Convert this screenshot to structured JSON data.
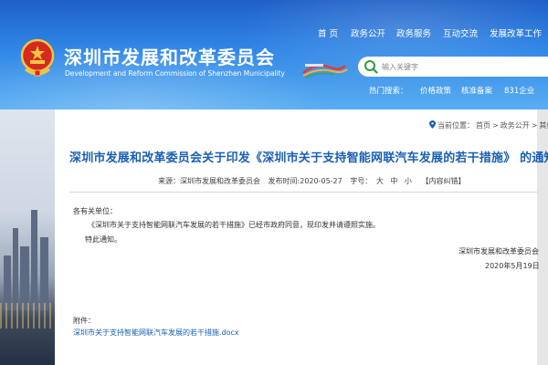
{
  "header": {
    "site_title": "深圳市发展和改革委员会",
    "site_subtitle": "Development and Reform Commission of Shenzhen Municipality",
    "nav": [
      "首 页",
      "政务公开",
      "政务服务",
      "互动交流",
      "发展改革工作"
    ]
  },
  "search": {
    "placeholder": "输入关键字"
  },
  "hot": {
    "label": "热门搜索：",
    "items": [
      "价格政策",
      "核准备案",
      "831企业"
    ]
  },
  "breadcrumb": {
    "items": [
      "当前位置：",
      "首页",
      ">",
      "政务公开",
      ">",
      "其他"
    ]
  },
  "article": {
    "title": "深圳市发展和改革委员会关于印发《深圳市关于支持智能网联汽车发展的若干措施》 的通知",
    "source": "来源：深圳市发展和改革委员会",
    "publish_time": "发布时间:2020-05-27",
    "font_size_label": "字号：",
    "font_sizes": [
      "大",
      "中",
      "小"
    ],
    "content_error": "【内容纠错】",
    "salutation": "各有关单位：",
    "body": "《深圳市关于支持智能网联汽车发展的若干措施》已经市政府同意，现印发并请遵照实施。",
    "closing": "特此通知。",
    "signature_org": "深圳市发展和改革委员会",
    "signature_date": "2020年5月19日",
    "attachment_label": "附件：",
    "attachment_link": "深圳市关于支持智能网联汽车发展的若干措施.docx"
  },
  "colors": {
    "header_blue": "#2f86e6",
    "title_blue": "#1a5fb4",
    "search_green": "#2e9b3c"
  }
}
